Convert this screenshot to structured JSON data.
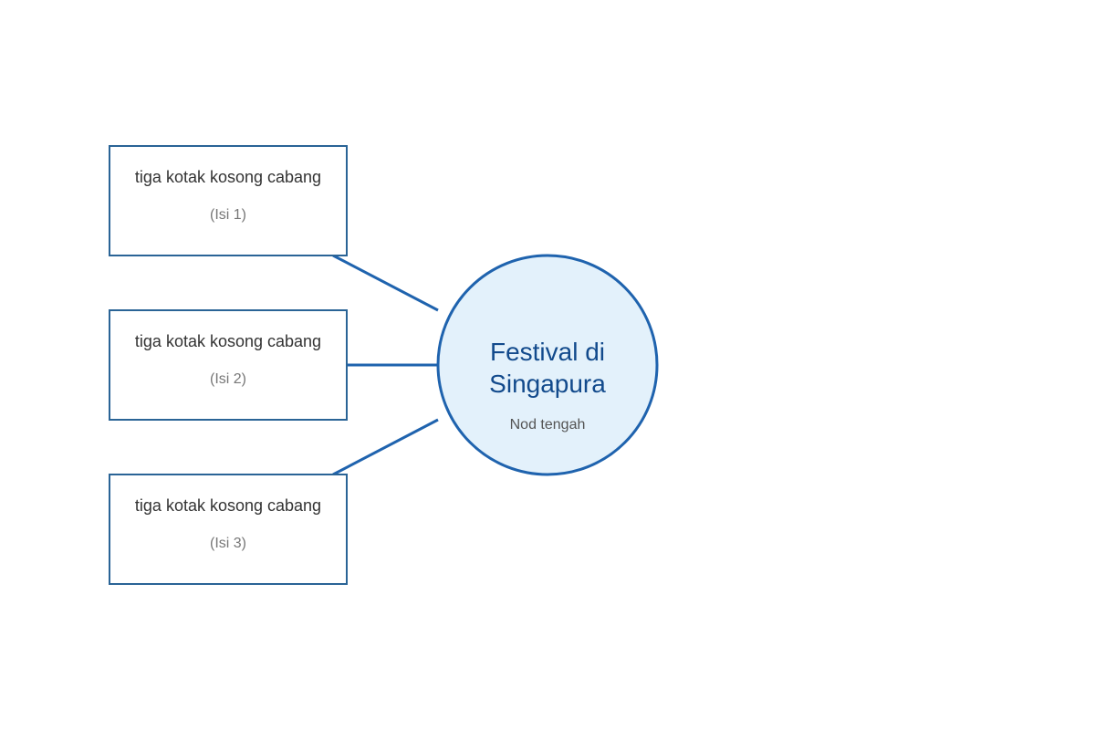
{
  "center": {
    "title_line1": "Festival di",
    "title_line2": "Singapura",
    "subtitle": "Nod tengah"
  },
  "branches": [
    {
      "title": "tiga kotak kosong cabang",
      "subtitle": "(Isi 1)"
    },
    {
      "title": "tiga kotak kosong cabang",
      "subtitle": "(Isi 2)"
    },
    {
      "title": "tiga kotak kosong cabang",
      "subtitle": "(Isi 3)"
    }
  ],
  "colors": {
    "accent": "#1f63ae",
    "box_border": "#2a6496",
    "center_fill": "#e3f1fb",
    "center_text": "#124a8c"
  }
}
